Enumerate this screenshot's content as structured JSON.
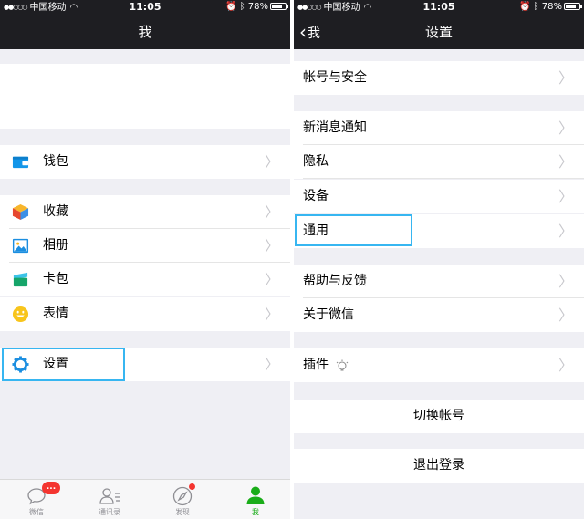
{
  "status": {
    "carrier": "中国移动",
    "time": "11:05",
    "battery": "78%"
  },
  "left": {
    "title": "我",
    "wallet": "钱包",
    "favorites": "收藏",
    "album": "相册",
    "cards": "卡包",
    "stickers": "表情",
    "settings": "设置",
    "tabs": [
      {
        "label": "微信",
        "badge": "..."
      },
      {
        "label": "通讯录"
      },
      {
        "label": "发现"
      },
      {
        "label": "我"
      }
    ]
  },
  "right": {
    "back": "我",
    "title": "设置",
    "account_security": "帐号与安全",
    "notifications": "新消息通知",
    "privacy": "隐私",
    "devices": "设备",
    "general": "通用",
    "help": "帮助与反馈",
    "about": "关于微信",
    "plugins": "插件",
    "switch_account": "切换帐号",
    "logout": "退出登录"
  },
  "colors": {
    "highlight": "#37b6f1",
    "wechat_green": "#1aad19",
    "badge_red": "#f43530"
  },
  "icons": {
    "wallet": "wallet-icon",
    "favorites": "cube-icon",
    "album": "picture-icon",
    "cards": "card-icon",
    "stickers": "smiley-icon",
    "settings": "gear-icon"
  }
}
